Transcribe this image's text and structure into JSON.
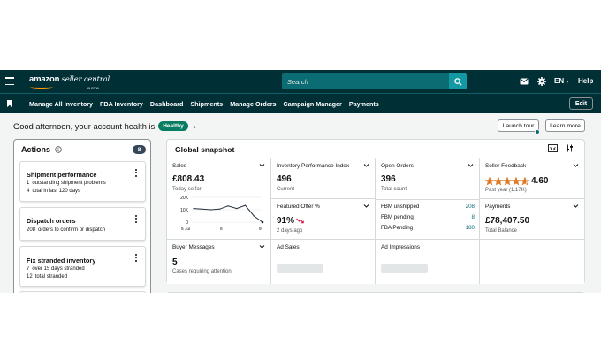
{
  "topbar": {
    "logo_main": "amazon",
    "logo_thin": "seller central",
    "logo_sub": "europe",
    "search_placeholder": "Search",
    "language": "EN",
    "help": "Help"
  },
  "navbar": {
    "items": [
      "Manage All Inventory",
      "FBA Inventory",
      "Dashboard",
      "Shipments",
      "Manage Orders",
      "Campaign Manager",
      "Payments"
    ],
    "edit_label": "Edit"
  },
  "greeting": {
    "text": "Good afternoon, your account health is",
    "status": "Healthy",
    "status_color": "#067d62",
    "launch_tour": "Launch tour",
    "learn_more": "Learn more"
  },
  "actions": {
    "title": "Actions",
    "count": "8",
    "cards": [
      {
        "title": "Shipment performance",
        "lines": [
          {
            "num": "1",
            "text": "outstanding shipment problems"
          },
          {
            "num": "4",
            "text": "total in last 120 days"
          }
        ]
      },
      {
        "title": "Dispatch orders",
        "lines": [
          {
            "num": "208",
            "text": "orders to confirm or dispatch"
          }
        ]
      },
      {
        "title": "Fix stranded inventory",
        "lines": [
          {
            "num": "7",
            "text": "over 15 days stranded"
          },
          {
            "num": "12",
            "text": "total stranded"
          }
        ]
      }
    ]
  },
  "snapshot": {
    "title": "Global snapshot",
    "sales": {
      "label": "Sales",
      "value": "£808.43",
      "sub": "Today so far"
    },
    "ipi": {
      "label": "Inventory Performance Index",
      "value": "496",
      "sub": "Current"
    },
    "open_orders": {
      "label": "Open Orders",
      "value": "396",
      "sub": "Total count",
      "rows": [
        {
          "label": "FBM unshipped",
          "value": "208"
        },
        {
          "label": "FBM pending",
          "value": "8"
        },
        {
          "label": "FBA Pending",
          "value": "180"
        }
      ]
    },
    "feedback": {
      "label": "Seller Feedback",
      "rating": "4.60",
      "stars": 4.6,
      "sub": "Past year (1.17K)"
    },
    "featured": {
      "label": "Featured Offer %",
      "value": "91%",
      "sub": "2 days ago"
    },
    "payments": {
      "label": "Payments",
      "value": "£78,407.50",
      "sub": "Total Balance"
    },
    "buyer_messages": {
      "label": "Buyer Messages",
      "value": "5",
      "sub": "Cases requiring attention"
    },
    "ad_sales": {
      "label": "Ad Sales"
    },
    "ad_impressions": {
      "label": "Ad Impressions"
    },
    "star_color": "#de7921"
  },
  "chart_data": {
    "type": "line",
    "x": [
      "5 Jul",
      "",
      "",
      "",
      "",
      "",
      "",
      "",
      "",
      "9"
    ],
    "x_ticks": [
      "5 Jul",
      "6",
      "9"
    ],
    "y_ticks": [
      "20K",
      "10K",
      "0"
    ],
    "values": [
      11000,
      10500,
      10000,
      10500,
      13000,
      11000,
      13500,
      5000,
      0
    ],
    "ylim": [
      0,
      20000
    ],
    "color": "#232f3e"
  }
}
